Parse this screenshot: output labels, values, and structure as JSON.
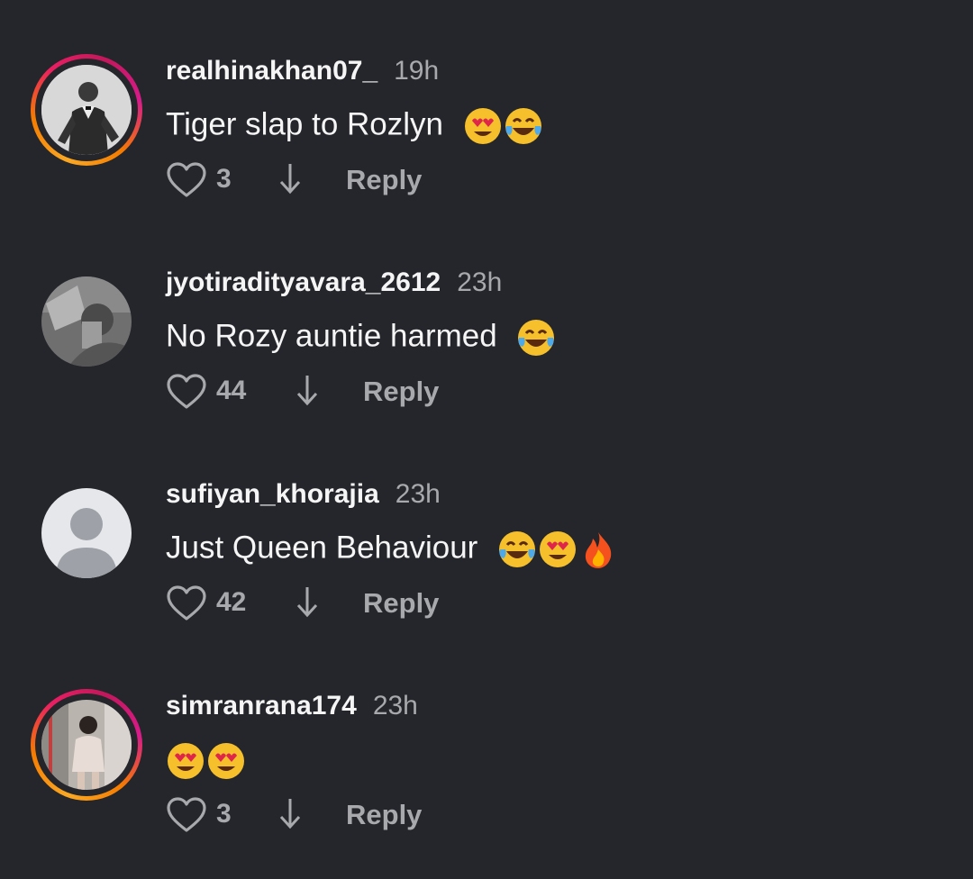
{
  "comments": [
    {
      "username": "realhinakhan07_",
      "time": "19h",
      "text": "Tiger slap to Rozlyn",
      "emojis": [
        "heart-eyes",
        "tears-of-joy"
      ],
      "likes": "3",
      "reply_label": "Reply",
      "avatar": "photo-man-suit",
      "has_story_ring": true
    },
    {
      "username": "jyotiradityavara_2612",
      "time": "23h",
      "text": "No Rozy auntie harmed",
      "emojis": [
        "tears-of-joy"
      ],
      "likes": "44",
      "reply_label": "Reply",
      "avatar": "photo-grayscale-selfie",
      "has_story_ring": false
    },
    {
      "username": "sufiyan_khorajia",
      "time": "23h",
      "text": "Just Queen Behaviour",
      "emojis": [
        "tears-of-joy",
        "heart-eyes",
        "fire"
      ],
      "likes": "42",
      "reply_label": "Reply",
      "avatar": "default-avatar",
      "has_story_ring": false
    },
    {
      "username": "simranrana174",
      "time": "23h",
      "text": "",
      "emojis": [
        "heart-eyes",
        "heart-eyes"
      ],
      "likes": "3",
      "reply_label": "Reply",
      "avatar": "photo-woman-dress",
      "has_story_ring": true
    }
  ],
  "colors": {
    "background": "#25262b",
    "primary_text": "#f5f5f5",
    "secondary_text": "#a8a9ad"
  }
}
